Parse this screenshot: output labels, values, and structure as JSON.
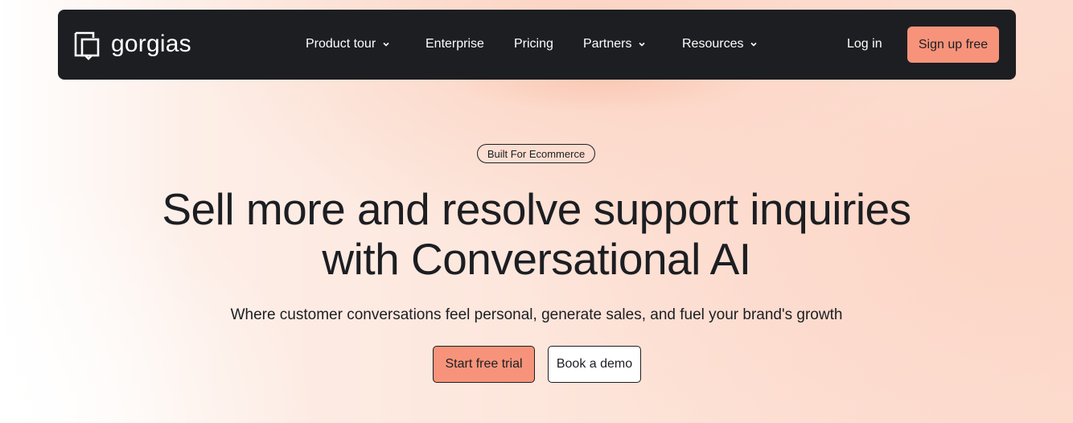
{
  "nav": {
    "logo_text": "gorgias",
    "items": [
      {
        "label": "Product tour",
        "has_dropdown": true
      },
      {
        "label": "Enterprise",
        "has_dropdown": false
      },
      {
        "label": "Pricing",
        "has_dropdown": false
      },
      {
        "label": "Partners",
        "has_dropdown": true
      },
      {
        "label": "Resources",
        "has_dropdown": true
      }
    ],
    "login_label": "Log in",
    "signup_label": "Sign up free"
  },
  "hero": {
    "badge": "Built For Ecommerce",
    "headline_line1": "Sell more and resolve support inquiries",
    "headline_line2": "with Conversational AI",
    "subtitle": "Where customer conversations feel personal, generate sales, and fuel your brand's growth",
    "primary_cta": "Start free trial",
    "secondary_cta": "Book a demo"
  },
  "colors": {
    "nav_bg": "#1c1e22",
    "accent": "#f7937a",
    "text": "#1c1e22"
  },
  "icons": {
    "logo": "gorgias-logo-icon",
    "dropdown": "chevron-down-icon"
  }
}
